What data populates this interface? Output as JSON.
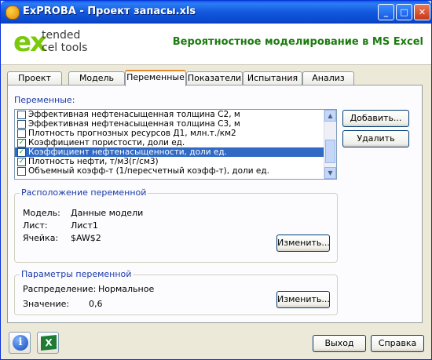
{
  "window": {
    "title": "ExPROBA - Проект запасы.xls"
  },
  "header": {
    "logo_ex": "ex",
    "logo_line1": "tended",
    "logo_line2": "cel tools",
    "slogan": "Вероятностное моделирование в MS Excel"
  },
  "tabs": [
    {
      "label": "Проект"
    },
    {
      "label": "Модель"
    },
    {
      "label": "Переменные",
      "active": true
    },
    {
      "label": "Показатели"
    },
    {
      "label": "Испытания"
    },
    {
      "label": "Анализ"
    }
  ],
  "variables": {
    "label": "Переменные:",
    "items": [
      {
        "label": "Эффективная нефтенасыщенная толщина С2, м",
        "checked": false,
        "selected": false
      },
      {
        "label": "Эффективная нефтенасыщенная толщина С3, м",
        "checked": false,
        "selected": false
      },
      {
        "label": "Плотность прогнозных ресурсов Д1, млн.т./км2",
        "checked": false,
        "selected": false
      },
      {
        "label": "Коэффициент пористости, доли ед.",
        "checked": true,
        "selected": false
      },
      {
        "label": "Коэффициент нефтенасыщенности, доли ед.",
        "checked": true,
        "selected": true
      },
      {
        "label": "Плотность нефти, т/м3(г/см3)",
        "checked": true,
        "selected": false
      },
      {
        "label": "Объемный коэфф-т (1/пересчетный коэфф-т), доли ед.",
        "checked": false,
        "selected": false
      }
    ],
    "add_button": "Добавить...",
    "delete_button": "Удалить"
  },
  "location": {
    "title": "Расположение переменной",
    "model_label": "Модель:",
    "model_value": "Данные модели",
    "sheet_label": "Лист:",
    "sheet_value": "Лист1",
    "cell_label": "Ячейка:",
    "cell_value": "$AW$2",
    "change_button": "Изменить..."
  },
  "params": {
    "title": "Параметры переменной",
    "dist_label": "Распределение:",
    "dist_value": "Нормальное",
    "value_label": "Значение:",
    "value_value": "0,6",
    "change_button": "Изменить..."
  },
  "footer": {
    "exit_button": "Выход",
    "help_button": "Справка"
  },
  "colors": {
    "accent": "#316ac5",
    "group_title": "#1a3aa8",
    "slogan": "#1b7c0f"
  }
}
